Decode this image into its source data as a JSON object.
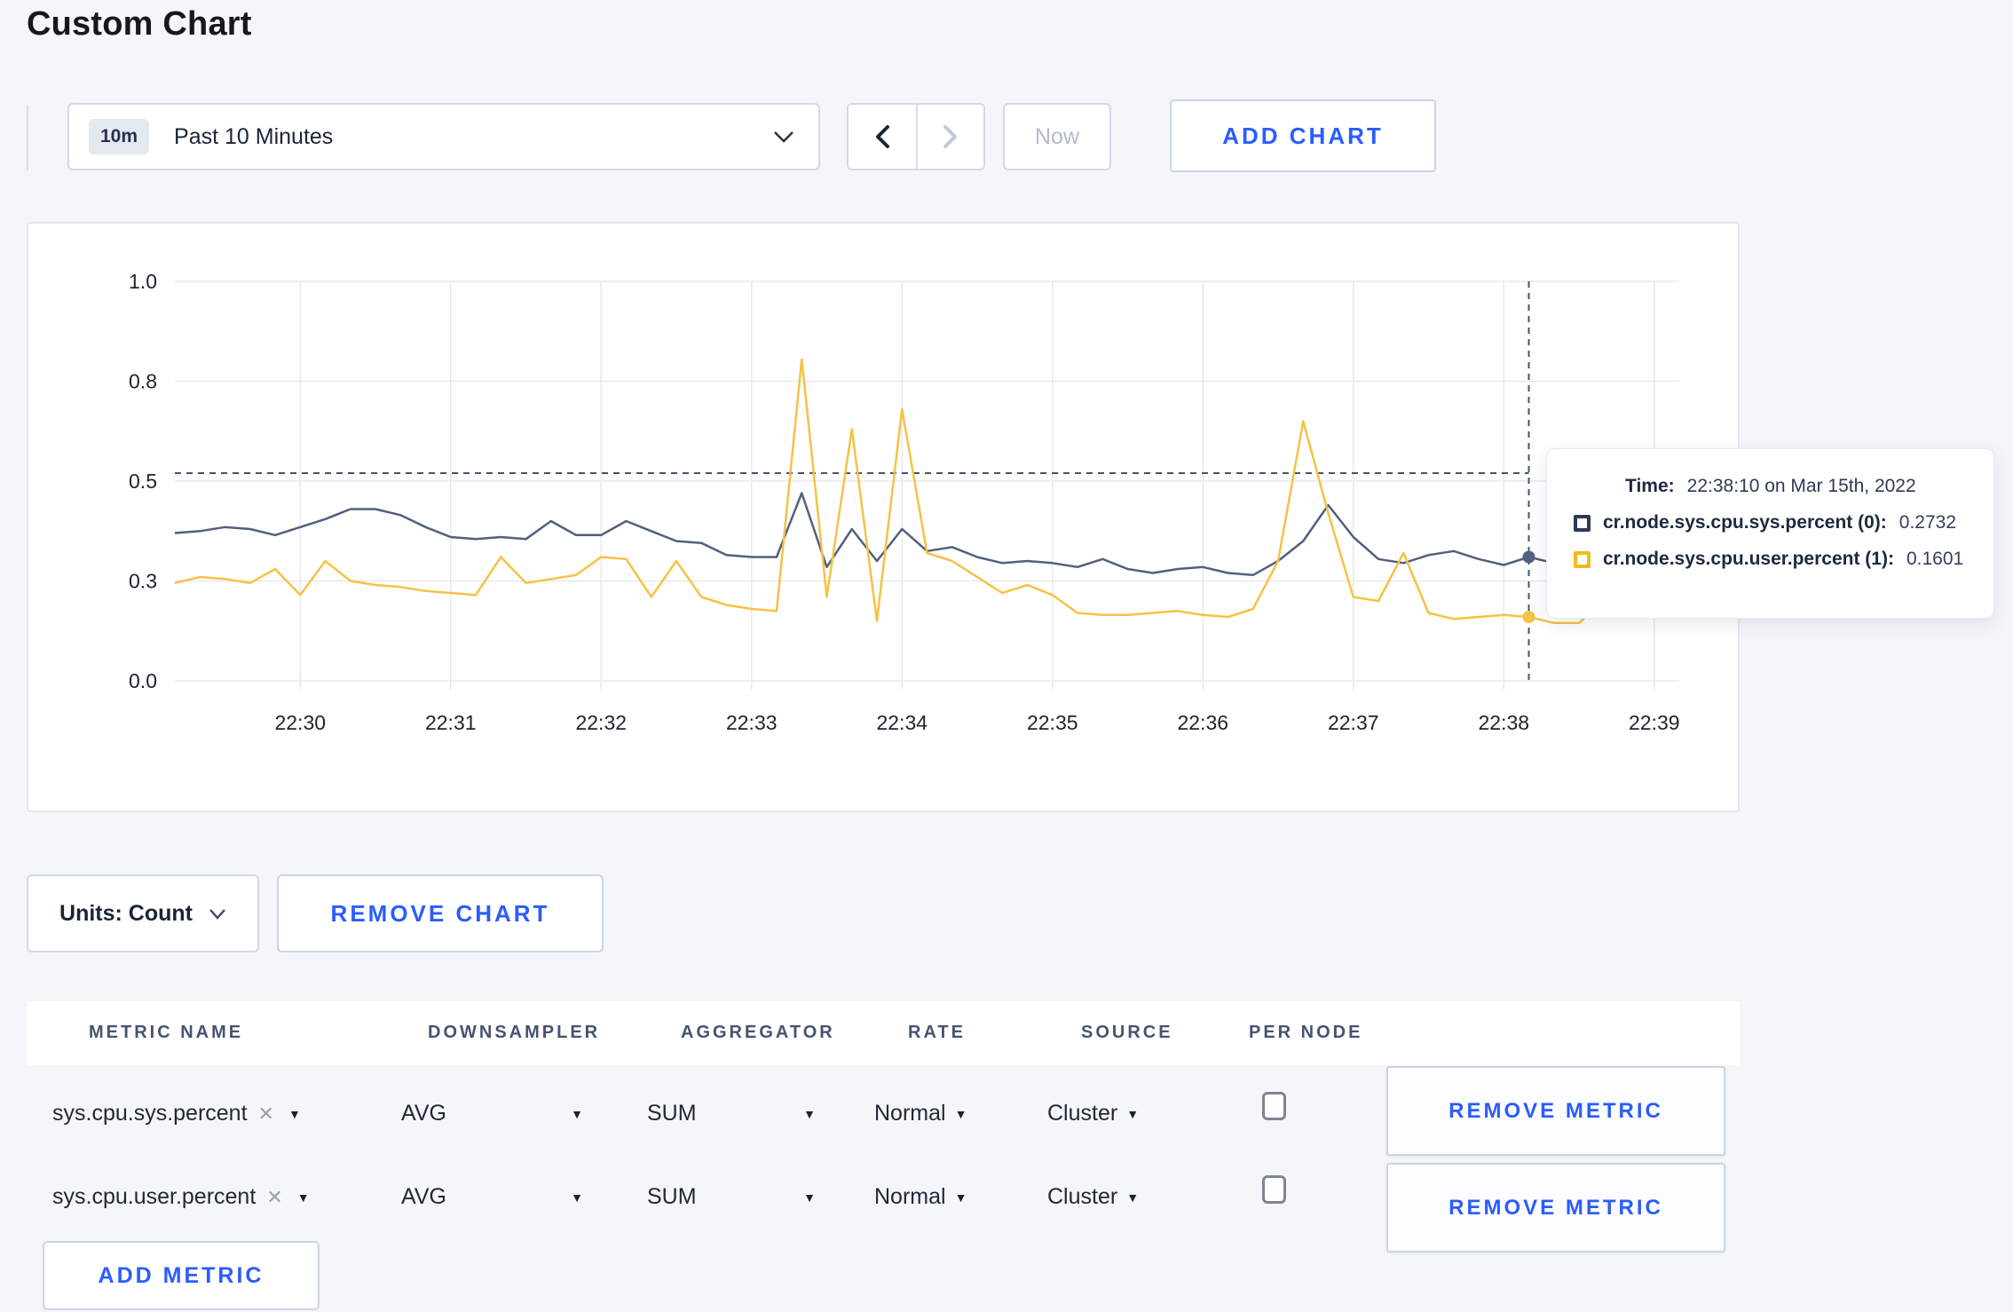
{
  "page": {
    "title": "Custom Chart"
  },
  "toolbar": {
    "time_range": {
      "badge": "10m",
      "label": "Past 10 Minutes"
    },
    "now_label": "Now",
    "add_chart_label": "ADD CHART"
  },
  "chart_data": {
    "type": "line",
    "x_start_time": "22:29:10",
    "point_interval_sec": 10,
    "duration_sec": 600,
    "y_range": [
      0,
      1
    ],
    "grid": true,
    "legend_position": "tooltip",
    "y_ticks": [
      {
        "value": 0,
        "label": "0.0"
      },
      {
        "value": 0.25,
        "label": "0.3"
      },
      {
        "value": 0.5,
        "label": "0.5"
      },
      {
        "value": 0.75,
        "label": "0.8"
      },
      {
        "value": 1,
        "label": "1.0"
      }
    ],
    "x_ticks": [
      {
        "offset_sec": 50,
        "label": "22:30"
      },
      {
        "offset_sec": 110,
        "label": "22:31"
      },
      {
        "offset_sec": 170,
        "label": "22:32"
      },
      {
        "offset_sec": 230,
        "label": "22:33"
      },
      {
        "offset_sec": 290,
        "label": "22:34"
      },
      {
        "offset_sec": 350,
        "label": "22:35"
      },
      {
        "offset_sec": 410,
        "label": "22:36"
      },
      {
        "offset_sec": 470,
        "label": "22:37"
      },
      {
        "offset_sec": 530,
        "label": "22:38"
      },
      {
        "offset_sec": 590,
        "label": "22:39"
      }
    ],
    "series": [
      {
        "name": "cr.node.sys.cpu.sys.percent",
        "color": "#51607e",
        "values": [
          0.37,
          0.375,
          0.385,
          0.38,
          0.365,
          0.385,
          0.405,
          0.43,
          0.43,
          0.415,
          0.385,
          0.36,
          0.355,
          0.36,
          0.355,
          0.4,
          0.365,
          0.365,
          0.4,
          0.375,
          0.35,
          0.345,
          0.315,
          0.31,
          0.31,
          0.47,
          0.285,
          0.38,
          0.3,
          0.38,
          0.325,
          0.335,
          0.31,
          0.295,
          0.3,
          0.295,
          0.285,
          0.305,
          0.28,
          0.27,
          0.28,
          0.285,
          0.27,
          0.265,
          0.3,
          0.35,
          0.44,
          0.36,
          0.305,
          0.295,
          0.315,
          0.325,
          0.305,
          0.29,
          0.31,
          0.295,
          0.3,
          0.295,
          0.3,
          0.305,
          0.3
        ]
      },
      {
        "name": "cr.node.sys.cpu.user.percent",
        "color": "#f6c244",
        "values": [
          0.245,
          0.26,
          0.255,
          0.245,
          0.28,
          0.215,
          0.3,
          0.25,
          0.24,
          0.235,
          0.225,
          0.22,
          0.215,
          0.31,
          0.245,
          0.255,
          0.265,
          0.31,
          0.305,
          0.21,
          0.3,
          0.21,
          0.19,
          0.18,
          0.175,
          0.805,
          0.21,
          0.63,
          0.15,
          0.68,
          0.32,
          0.3,
          0.26,
          0.22,
          0.24,
          0.215,
          0.17,
          0.165,
          0.165,
          0.17,
          0.175,
          0.165,
          0.16,
          0.18,
          0.3,
          0.65,
          0.42,
          0.21,
          0.2,
          0.32,
          0.17,
          0.155,
          0.16,
          0.165,
          0.16,
          0.145,
          0.145,
          0.2,
          0.3,
          0.255,
          0.22
        ]
      }
    ],
    "hover": {
      "point_index": 54,
      "crosshair_value": 0.52,
      "crosshair_color": "#44536f"
    }
  },
  "tooltip": {
    "time_label": "Time:",
    "time_value": "22:38:10 on Mar 15th, 2022",
    "rows": [
      {
        "name": "cr.node.sys.cpu.sys.percent (0):",
        "value": "0.2732",
        "color": "#2c3a57"
      },
      {
        "name": "cr.node.sys.cpu.user.percent (1):",
        "value": "0.1601",
        "color": "#f5b91e"
      }
    ]
  },
  "chart_footer": {
    "units_label": "Units: Count",
    "remove_chart_label": "REMOVE CHART"
  },
  "metrics_table": {
    "headers": [
      "METRIC NAME",
      "DOWNSAMPLER",
      "AGGREGATOR",
      "RATE",
      "SOURCE",
      "PER NODE"
    ],
    "rows": [
      {
        "metric": "sys.cpu.sys.percent",
        "downsampler": "AVG",
        "aggregator": "SUM",
        "rate": "Normal",
        "source": "Cluster",
        "per_node_checked": false,
        "remove_label": "REMOVE METRIC"
      },
      {
        "metric": "sys.cpu.user.percent",
        "downsampler": "AVG",
        "aggregator": "SUM",
        "rate": "Normal",
        "source": "Cluster",
        "per_node_checked": false,
        "remove_label": "REMOVE METRIC"
      }
    ],
    "add_metric_label": "ADD METRIC"
  }
}
